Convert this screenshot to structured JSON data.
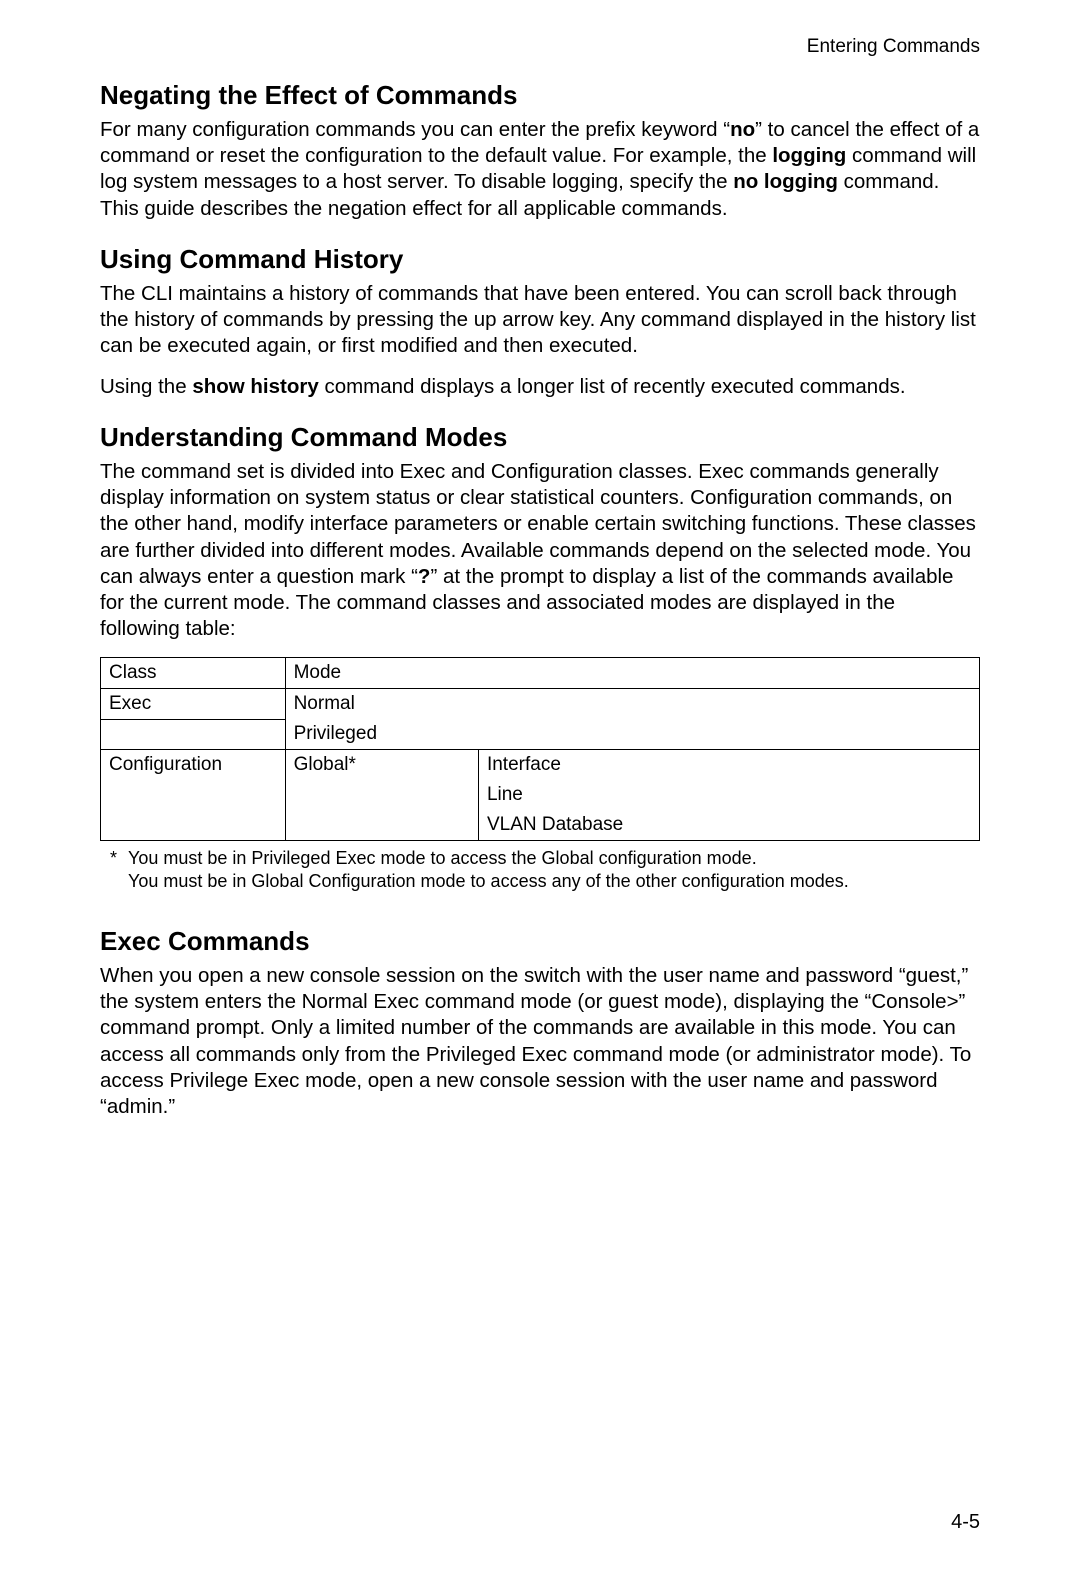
{
  "running_head": "Entering Commands",
  "page_number": "4-5",
  "sec1": {
    "heading": "Negating the Effect of Commands",
    "p1_a": "For many configuration commands you can enter the prefix keyword “",
    "p1_kw1": "no",
    "p1_b": "” to cancel the effect of a command or reset the configuration to the default value. For example, the ",
    "p1_kw2": "logging",
    "p1_c": " command will log system messages to a host server. To disable logging, specify the ",
    "p1_kw3": "no logging",
    "p1_d": " command. This guide describes the negation effect for all applicable commands."
  },
  "sec2": {
    "heading": "Using Command History",
    "p1": "The CLI maintains a history of commands that have been entered. You can scroll back through the history of commands by pressing the up arrow key. Any command displayed in the history list can be executed again, or first modified and then executed.",
    "p2_a": "Using the ",
    "p2_kw": "show history",
    "p2_b": " command displays a longer list of recently executed commands."
  },
  "sec3": {
    "heading": "Understanding Command Modes",
    "p1_a": "The command set is divided into Exec and Configuration classes. Exec commands generally display information on system status or clear statistical counters. Configuration commands, on the other hand, modify interface parameters or enable certain switching functions. These classes are further divided into different modes. Available commands depend on the selected mode. You can always enter a question mark “",
    "p1_kw": "?",
    "p1_b": "” at the prompt to display a list of the commands available for the current mode. The command classes and associated modes are displayed in the following table:",
    "table": {
      "head": {
        "c1": "Class",
        "c2": "Mode"
      },
      "row_exec": {
        "class": "Exec",
        "mode1": "Normal",
        "mode2": "Privileged"
      },
      "row_conf": {
        "class": "Configuration",
        "mode": "Global*",
        "sub1": "Interface",
        "sub2": "Line",
        "sub3": "VLAN Database"
      }
    },
    "footnote_star": "*",
    "footnote1": "You must be in Privileged Exec mode to access the Global configuration mode.",
    "footnote2": "You must be in Global Configuration mode to access any of the other configuration modes."
  },
  "sec4": {
    "heading": "Exec Commands",
    "p1": "When you open a new console session on the switch with the user name and password “guest,” the system enters the Normal Exec command mode (or guest mode), displaying the “Console>” command prompt. Only a limited number of the commands are available in this mode. You can access all commands only from the Privileged Exec command mode (or administrator mode). To access Privilege Exec mode, open a new console session with the user name and password “admin.”"
  }
}
